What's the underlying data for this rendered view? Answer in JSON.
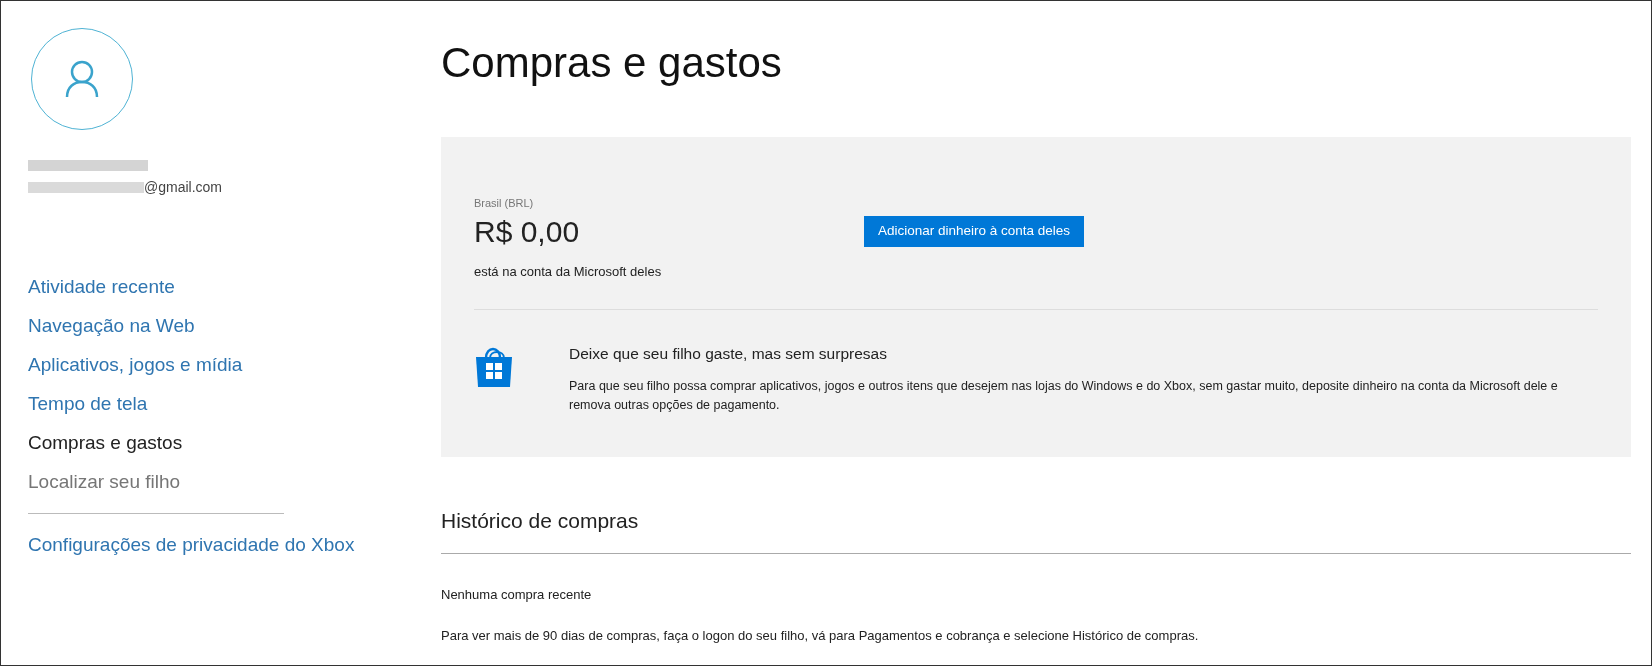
{
  "profile": {
    "email": "@gmail.com"
  },
  "nav": {
    "items": [
      {
        "label": "Atividade recente",
        "selected": false,
        "disabled": false
      },
      {
        "label": "Navegação na Web",
        "selected": false,
        "disabled": false
      },
      {
        "label": "Aplicativos, jogos e mídia",
        "selected": false,
        "disabled": false
      },
      {
        "label": "Tempo de tela",
        "selected": false,
        "disabled": false
      },
      {
        "label": "Compras e gastos",
        "selected": true,
        "disabled": false
      },
      {
        "label": "Localizar seu filho",
        "selected": false,
        "disabled": true
      }
    ],
    "footer_link": "Configurações de privacidade do Xbox"
  },
  "page_title": "Compras e gastos",
  "balance": {
    "region": "Brasil (BRL)",
    "amount": "R$ 0,00",
    "caption": "está na conta da Microsoft deles",
    "button": "Adicionar dinheiro à conta deles"
  },
  "tip": {
    "title": "Deixe que seu filho gaste, mas sem surpresas",
    "body": "Para que seu filho possa comprar aplicativos, jogos e outros itens que desejem nas lojas do Windows e do Xbox, sem gastar muito, deposite dinheiro na conta da Microsoft dele e remova outras opções de pagamento."
  },
  "history": {
    "title": "Histórico de compras",
    "empty": "Nenhuma compra recente",
    "note": "Para ver mais de 90 dias de compras, faça o logon do seu filho, vá para Pagamentos e cobrança e selecione Histórico de compras."
  }
}
